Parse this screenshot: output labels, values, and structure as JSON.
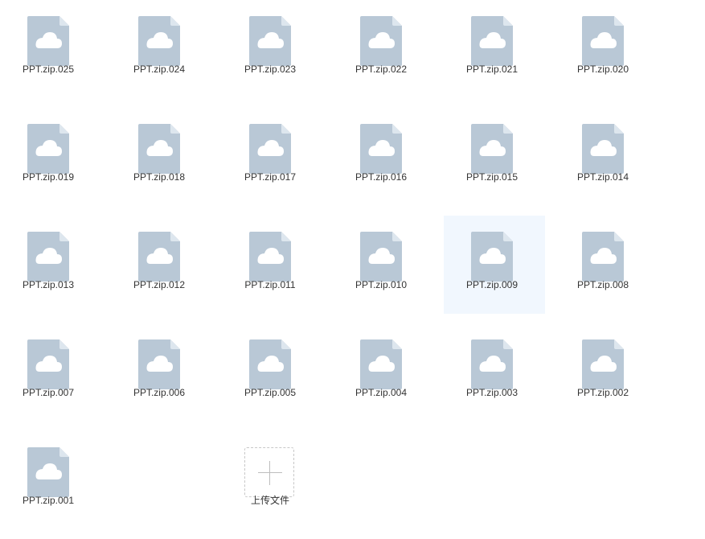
{
  "files": [
    {
      "name": "PPT.zip.025"
    },
    {
      "name": "PPT.zip.024"
    },
    {
      "name": "PPT.zip.023"
    },
    {
      "name": "PPT.zip.022"
    },
    {
      "name": "PPT.zip.021"
    },
    {
      "name": "PPT.zip.020"
    },
    {
      "name": "PPT.zip.019"
    },
    {
      "name": "PPT.zip.018"
    },
    {
      "name": "PPT.zip.017"
    },
    {
      "name": "PPT.zip.016"
    },
    {
      "name": "PPT.zip.015"
    },
    {
      "name": "PPT.zip.014"
    },
    {
      "name": "PPT.zip.013"
    },
    {
      "name": "PPT.zip.012"
    },
    {
      "name": "PPT.zip.011"
    },
    {
      "name": "PPT.zip.010"
    },
    {
      "name": "PPT.zip.009"
    },
    {
      "name": "PPT.zip.008"
    },
    {
      "name": "PPT.zip.007"
    },
    {
      "name": "PPT.zip.006"
    },
    {
      "name": "PPT.zip.005"
    },
    {
      "name": "PPT.zip.004"
    },
    {
      "name": "PPT.zip.003"
    },
    {
      "name": "PPT.zip.002"
    },
    {
      "name": "PPT.zip.001"
    }
  ],
  "upload": {
    "label": "上传文件",
    "icon": "plus-icon"
  },
  "icons": {
    "file": "cloud-file-icon"
  },
  "colors": {
    "file_body": "#b9c8d6",
    "file_fold": "#dde6ee",
    "cloud": "#ffffff",
    "hover_bg": "#f1f7fe",
    "text": "#333333",
    "upload_border": "#c7c7c7",
    "plus": "#bdbdbd"
  },
  "state": {
    "hovered_file": "PPT.zip.009"
  }
}
